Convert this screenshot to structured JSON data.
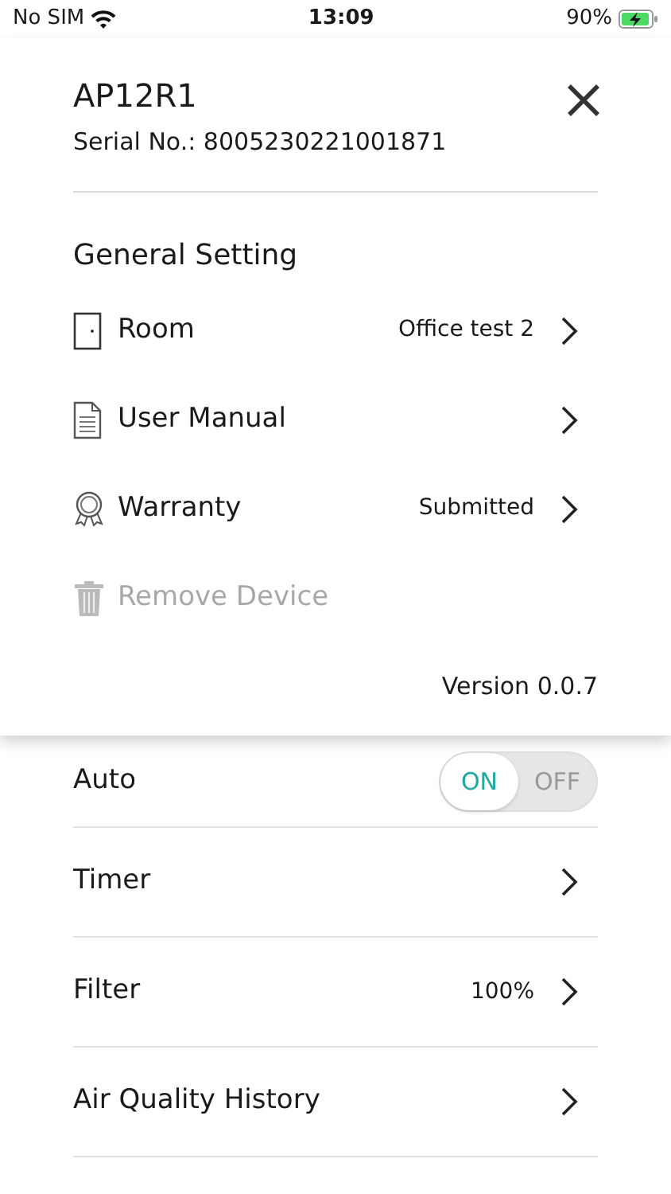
{
  "status_bar": {
    "carrier": "No SIM",
    "time": "13:09",
    "battery": "90%",
    "charging": true
  },
  "device": {
    "title": "AP12R1",
    "serial": "Serial No.: 8005230221001871"
  },
  "general": {
    "heading": "General Setting",
    "items": [
      {
        "kind": "door",
        "label": "Room",
        "value": "Office test 2",
        "disabled": false
      },
      {
        "kind": "document",
        "label": "User Manual",
        "disabled": false
      },
      {
        "kind": "award",
        "label": "Warranty",
        "value": "Submitted",
        "disabled": false
      },
      {
        "kind": "trash",
        "label": "Remove Device",
        "disabled": true
      }
    ],
    "version": "Version 0.0.7"
  },
  "settings": [
    {
      "kind": "toggle",
      "label": "Auto",
      "on_label": "ON",
      "off_label": "OFF",
      "on": true
    },
    {
      "kind": "link",
      "label": "Timer"
    },
    {
      "kind": "link",
      "label": "Filter",
      "value": "100%"
    },
    {
      "kind": "link",
      "label": "Air Quality History"
    }
  ]
}
